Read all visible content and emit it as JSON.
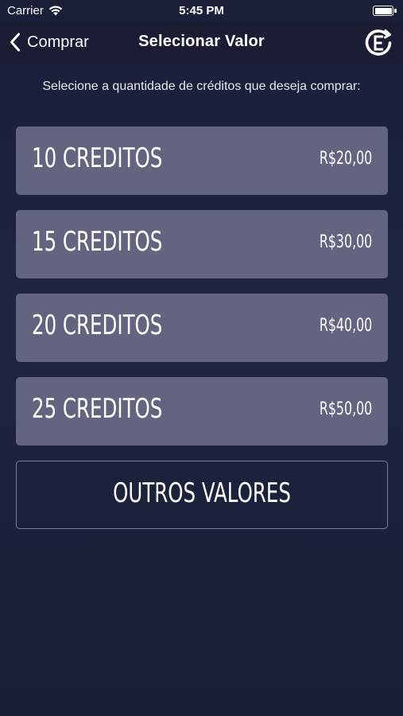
{
  "status_bar": {
    "carrier": "Carrier",
    "time": "5:45 PM",
    "icons": [
      "wifi-icon",
      "battery-icon"
    ]
  },
  "nav": {
    "back_label": "Comprar",
    "title": "Selecionar Valor",
    "back_icon": "chevron-left-icon",
    "logo_icon": "app-logo-icon"
  },
  "instruction": "Selecione a quantidade de créditos que deseja comprar:",
  "options": [
    {
      "label": "10 CREDITOS",
      "price": "R$20,00"
    },
    {
      "label": "15 CREDITOS",
      "price": "R$30,00"
    },
    {
      "label": "20 CREDITOS",
      "price": "R$40,00"
    },
    {
      "label": "25 CREDITOS",
      "price": "R$50,00"
    }
  ],
  "other_values_label": "OUTROS VALORES",
  "colors": {
    "background": "#1f2440",
    "navbar": "#1a1d33",
    "option_fill": "#63647f",
    "outline": "#7b7d96",
    "text": "#ffffff"
  }
}
